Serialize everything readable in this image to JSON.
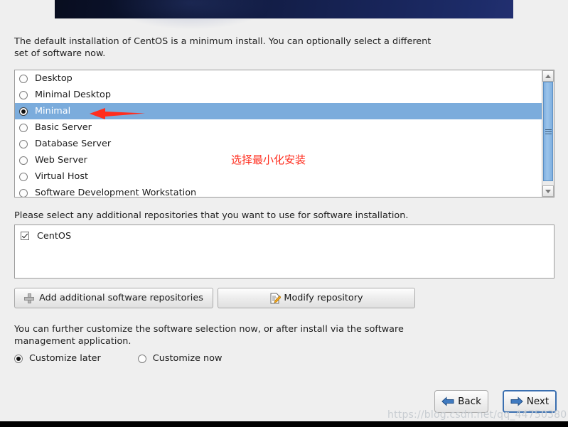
{
  "banner": {
    "name": "centos-installer-banner"
  },
  "intro": {
    "text": "The default installation of CentOS is a minimum install. You can optionally select a different set of software now."
  },
  "software_groups": {
    "items": [
      {
        "label": "Desktop",
        "selected": false
      },
      {
        "label": "Minimal Desktop",
        "selected": false
      },
      {
        "label": "Minimal",
        "selected": true
      },
      {
        "label": "Basic Server",
        "selected": false
      },
      {
        "label": "Database Server",
        "selected": false
      },
      {
        "label": "Web Server",
        "selected": false
      },
      {
        "label": "Virtual Host",
        "selected": false
      },
      {
        "label": "Software Development Workstation",
        "selected": false
      }
    ]
  },
  "annotation": {
    "text": "选择最小化安装",
    "color": "#ff2d1e"
  },
  "repositories": {
    "prompt": "Please select any additional repositories that you want to use for software installation.",
    "items": [
      {
        "label": "CentOS",
        "checked": true
      }
    ],
    "add_button_label": "Add additional software repositories",
    "modify_button_label": "Modify repository"
  },
  "customize": {
    "prompt": "You can further customize the software selection now, or after install via the software management application.",
    "later_label": "Customize later",
    "now_label": "Customize now",
    "selected": "later"
  },
  "navigation": {
    "back_label": "Back",
    "next_label": "Next"
  },
  "watermark": {
    "text": "https://blog.csdn.net/qq_44750380"
  },
  "colors": {
    "selection_blue": "#7bacdc",
    "banner_navy": "#131e48",
    "annotation_red": "#ff2d1e",
    "focus_blue": "#3a6fb0"
  }
}
